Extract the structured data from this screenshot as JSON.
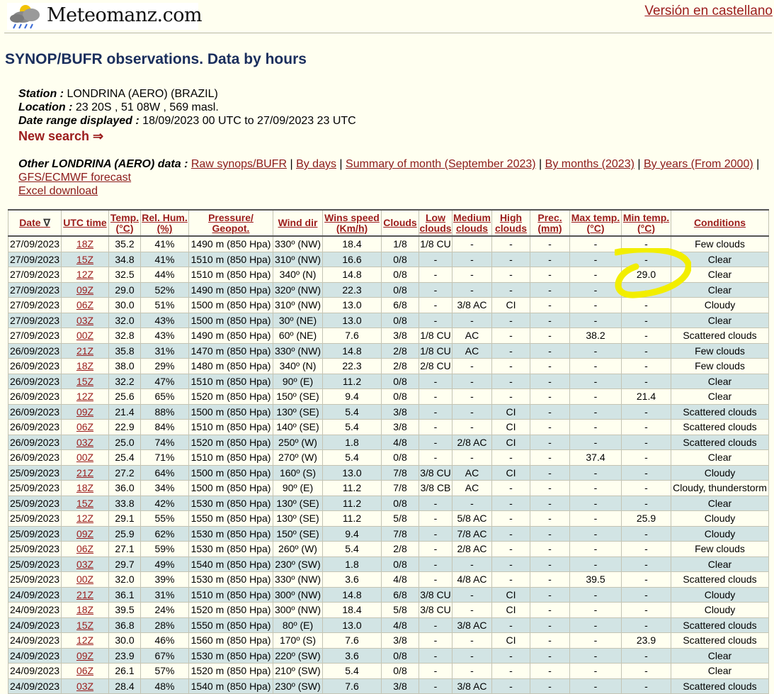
{
  "header": {
    "logo_text": "Meteomanz.com",
    "language_link": "Versión en castellano"
  },
  "page_title": "SYNOP/BUFR observations. Data by hours",
  "station": {
    "station_label": "Station :",
    "station_value": "LONDRINA (AERO) (BRAZIL)",
    "location_label": "Location :",
    "location_value": "23 20S , 51 08W , 569 masl.",
    "range_label": "Date range displayed :",
    "range_value": "18/09/2023 00 UTC to 27/09/2023 23 UTC",
    "new_search": "New search ⇒"
  },
  "other": {
    "label": "Other LONDRINA (AERO) data :",
    "links": [
      "Raw synops/BUFR",
      "By days",
      "Summary of month (September 2023)",
      "By months (2023)",
      "By years (From 2000)",
      "GFS/ECMWF forecast"
    ],
    "excel": "Excel download"
  },
  "table": {
    "headers": {
      "date": "Date",
      "date_arrow": "∇",
      "utc": "UTC time",
      "temp1": "Temp.",
      "temp2": "(°C)",
      "hum1": "Rel. Hum.",
      "hum2": "(%)",
      "press1": "Pressure/",
      "press2": "Geopot.",
      "wdir": "Wind dir",
      "wspd1": "Wins speed",
      "wspd2": "(Km/h)",
      "clouds": "Clouds",
      "low1": "Low",
      "low2": "clouds",
      "med1": "Medium",
      "med2": "clouds",
      "high1": "High",
      "high2": "clouds",
      "prec1": "Prec.",
      "prec2": "(mm)",
      "max1": "Max temp.",
      "max2": "(°C)",
      "min1": "Min temp.",
      "min2": "(°C)",
      "cond": "Conditions"
    },
    "rows": [
      [
        "27/09/2023",
        "18Z",
        "35.2",
        "41%",
        "1490 m (850 Hpa)",
        "330º (NW)",
        "18.4",
        "1/8",
        "1/8 CU",
        "-",
        "-",
        "-",
        "-",
        "-",
        "Few clouds"
      ],
      [
        "27/09/2023",
        "15Z",
        "34.8",
        "41%",
        "1510 m (850 Hpa)",
        "310º (NW)",
        "16.6",
        "0/8",
        "-",
        "-",
        "-",
        "-",
        "-",
        "-",
        "Clear"
      ],
      [
        "27/09/2023",
        "12Z",
        "32.5",
        "44%",
        "1510 m (850 Hpa)",
        "340º (N)",
        "14.8",
        "0/8",
        "-",
        "-",
        "-",
        "-",
        "-",
        "29.0",
        "Clear"
      ],
      [
        "27/09/2023",
        "09Z",
        "29.0",
        "52%",
        "1490 m (850 Hpa)",
        "320º (NW)",
        "22.3",
        "0/8",
        "-",
        "-",
        "-",
        "-",
        "-",
        "-",
        "Clear"
      ],
      [
        "27/09/2023",
        "06Z",
        "30.0",
        "51%",
        "1500 m (850 Hpa)",
        "310º (NW)",
        "13.0",
        "6/8",
        "-",
        "3/8 AC",
        "CI",
        "-",
        "-",
        "-",
        "Cloudy"
      ],
      [
        "27/09/2023",
        "03Z",
        "32.0",
        "43%",
        "1500 m (850 Hpa)",
        "30º (NE)",
        "13.0",
        "0/8",
        "-",
        "-",
        "-",
        "-",
        "-",
        "-",
        "Clear"
      ],
      [
        "27/09/2023",
        "00Z",
        "32.8",
        "43%",
        "1490 m (850 Hpa)",
        "60º (NE)",
        "7.6",
        "3/8",
        "1/8 CU",
        "AC",
        "-",
        "-",
        "38.2",
        "-",
        "Scattered clouds"
      ],
      [
        "26/09/2023",
        "21Z",
        "35.8",
        "31%",
        "1470 m (850 Hpa)",
        "330º (NW)",
        "14.8",
        "2/8",
        "1/8 CU",
        "AC",
        "-",
        "-",
        "-",
        "-",
        "Few clouds"
      ],
      [
        "26/09/2023",
        "18Z",
        "38.0",
        "29%",
        "1480 m (850 Hpa)",
        "340º (N)",
        "22.3",
        "2/8",
        "2/8 CU",
        "-",
        "-",
        "-",
        "-",
        "-",
        "Few clouds"
      ],
      [
        "26/09/2023",
        "15Z",
        "32.2",
        "47%",
        "1510 m (850 Hpa)",
        "90º (E)",
        "11.2",
        "0/8",
        "-",
        "-",
        "-",
        "-",
        "-",
        "-",
        "Clear"
      ],
      [
        "26/09/2023",
        "12Z",
        "25.6",
        "65%",
        "1520 m (850 Hpa)",
        "150º (SE)",
        "9.4",
        "0/8",
        "-",
        "-",
        "-",
        "-",
        "-",
        "21.4",
        "Clear"
      ],
      [
        "26/09/2023",
        "09Z",
        "21.4",
        "88%",
        "1500 m (850 Hpa)",
        "130º (SE)",
        "5.4",
        "3/8",
        "-",
        "-",
        "CI",
        "-",
        "-",
        "-",
        "Scattered clouds"
      ],
      [
        "26/09/2023",
        "06Z",
        "22.9",
        "84%",
        "1510 m (850 Hpa)",
        "140º (SE)",
        "5.4",
        "3/8",
        "-",
        "-",
        "CI",
        "-",
        "-",
        "-",
        "Scattered clouds"
      ],
      [
        "26/09/2023",
        "03Z",
        "25.0",
        "74%",
        "1520 m (850 Hpa)",
        "250º (W)",
        "1.8",
        "4/8",
        "-",
        "2/8 AC",
        "CI",
        "-",
        "-",
        "-",
        "Scattered clouds"
      ],
      [
        "26/09/2023",
        "00Z",
        "25.4",
        "71%",
        "1510 m (850 Hpa)",
        "270º (W)",
        "5.4",
        "0/8",
        "-",
        "-",
        "-",
        "-",
        "37.4",
        "-",
        "Clear"
      ],
      [
        "25/09/2023",
        "21Z",
        "27.2",
        "64%",
        "1500 m (850 Hpa)",
        "160º (S)",
        "13.0",
        "7/8",
        "3/8 CU",
        "AC",
        "CI",
        "-",
        "-",
        "-",
        "Cloudy"
      ],
      [
        "25/09/2023",
        "18Z",
        "36.0",
        "34%",
        "1500 m (850 Hpa)",
        "90º (E)",
        "11.2",
        "7/8",
        "3/8 CB",
        "AC",
        "-",
        "-",
        "-",
        "-",
        "Cloudy, thunderstorm"
      ],
      [
        "25/09/2023",
        "15Z",
        "33.8",
        "42%",
        "1530 m (850 Hpa)",
        "130º (SE)",
        "11.2",
        "0/8",
        "-",
        "-",
        "-",
        "-",
        "-",
        "-",
        "Clear"
      ],
      [
        "25/09/2023",
        "12Z",
        "29.1",
        "55%",
        "1550 m (850 Hpa)",
        "130º (SE)",
        "11.2",
        "5/8",
        "-",
        "5/8 AC",
        "-",
        "-",
        "-",
        "25.9",
        "Cloudy"
      ],
      [
        "25/09/2023",
        "09Z",
        "25.9",
        "62%",
        "1530 m (850 Hpa)",
        "150º (SE)",
        "9.4",
        "7/8",
        "-",
        "7/8 AC",
        "-",
        "-",
        "-",
        "-",
        "Cloudy"
      ],
      [
        "25/09/2023",
        "06Z",
        "27.1",
        "59%",
        "1530 m (850 Hpa)",
        "260º (W)",
        "5.4",
        "2/8",
        "-",
        "2/8 AC",
        "-",
        "-",
        "-",
        "-",
        "Few clouds"
      ],
      [
        "25/09/2023",
        "03Z",
        "29.7",
        "49%",
        "1540 m (850 Hpa)",
        "230º (SW)",
        "1.8",
        "0/8",
        "-",
        "-",
        "-",
        "-",
        "-",
        "-",
        "Clear"
      ],
      [
        "25/09/2023",
        "00Z",
        "32.0",
        "39%",
        "1530 m (850 Hpa)",
        "330º (NW)",
        "3.6",
        "4/8",
        "-",
        "4/8 AC",
        "-",
        "-",
        "39.5",
        "-",
        "Scattered clouds"
      ],
      [
        "24/09/2023",
        "21Z",
        "36.1",
        "31%",
        "1510 m (850 Hpa)",
        "300º (NW)",
        "14.8",
        "6/8",
        "3/8 CU",
        "-",
        "CI",
        "-",
        "-",
        "-",
        "Cloudy"
      ],
      [
        "24/09/2023",
        "18Z",
        "39.5",
        "24%",
        "1520 m (850 Hpa)",
        "300º (NW)",
        "18.4",
        "5/8",
        "3/8 CU",
        "-",
        "CI",
        "-",
        "-",
        "-",
        "Cloudy"
      ],
      [
        "24/09/2023",
        "15Z",
        "36.8",
        "28%",
        "1550 m (850 Hpa)",
        "80º (E)",
        "13.0",
        "4/8",
        "-",
        "3/8 AC",
        "-",
        "-",
        "-",
        "-",
        "Scattered clouds"
      ],
      [
        "24/09/2023",
        "12Z",
        "30.0",
        "46%",
        "1560 m (850 Hpa)",
        "170º (S)",
        "7.6",
        "3/8",
        "-",
        "-",
        "CI",
        "-",
        "-",
        "23.9",
        "Scattered clouds"
      ],
      [
        "24/09/2023",
        "09Z",
        "23.9",
        "67%",
        "1530 m (850 Hpa)",
        "220º (SW)",
        "3.6",
        "0/8",
        "-",
        "-",
        "-",
        "-",
        "-",
        "-",
        "Clear"
      ],
      [
        "24/09/2023",
        "06Z",
        "26.1",
        "57%",
        "1520 m (850 Hpa)",
        "210º (SW)",
        "5.4",
        "0/8",
        "-",
        "-",
        "-",
        "-",
        "-",
        "-",
        "Clear"
      ],
      [
        "24/09/2023",
        "03Z",
        "28.4",
        "48%",
        "1540 m (850 Hpa)",
        "230º (SW)",
        "7.6",
        "3/8",
        "-",
        "3/8 AC",
        "-",
        "-",
        "-",
        "-",
        "Scattered clouds"
      ]
    ]
  },
  "annotation": {
    "color": "#f2ee00"
  }
}
